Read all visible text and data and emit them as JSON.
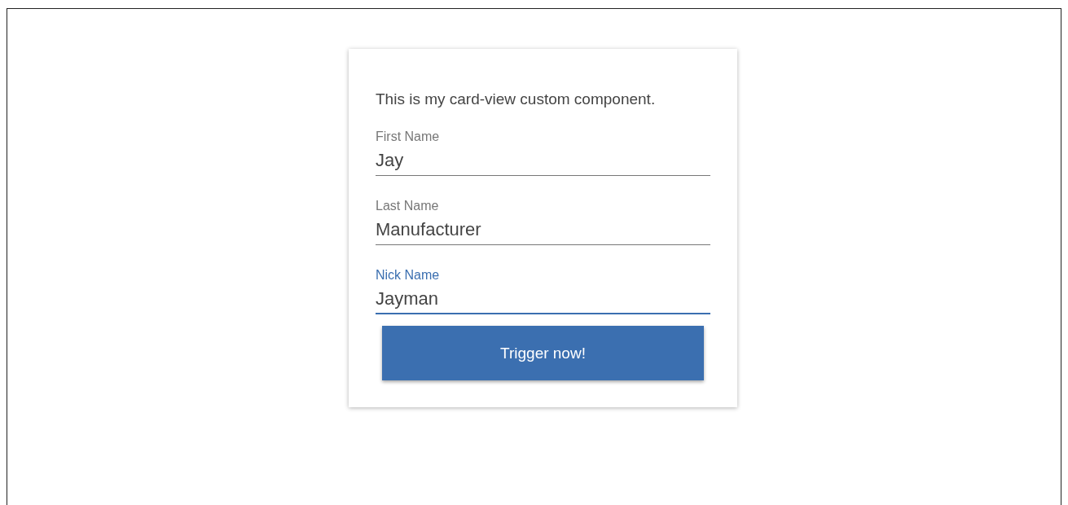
{
  "card": {
    "description": "This is my card-view custom component.",
    "fields": [
      {
        "label": "First Name",
        "value": "Jay",
        "focused": false
      },
      {
        "label": "Last Name",
        "value": "Manufacturer",
        "focused": false
      },
      {
        "label": "Nick Name",
        "value": "Jayman",
        "focused": true
      }
    ],
    "button": {
      "label": "Trigger now!"
    }
  }
}
